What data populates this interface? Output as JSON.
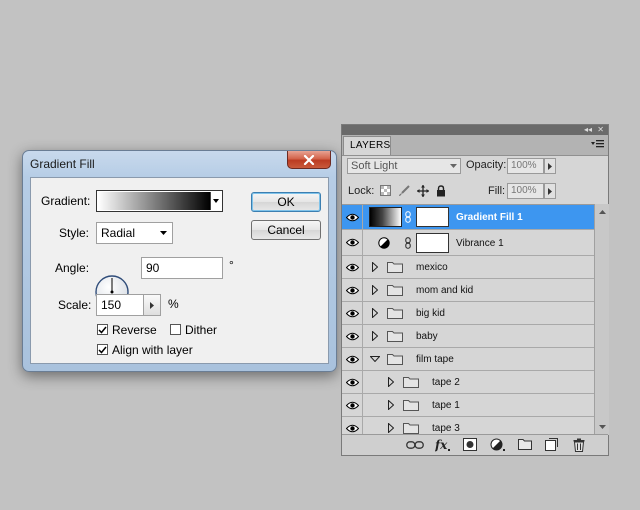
{
  "dialog": {
    "title": "Gradient Fill",
    "gradient_label": "Gradient:",
    "style_label": "Style:",
    "style_value": "Radial",
    "angle_label": "Angle:",
    "angle_value": "90",
    "angle_unit": "°",
    "scale_label": "Scale:",
    "scale_value": "150",
    "scale_unit": "%",
    "reverse_label": "Reverse",
    "reverse_checked": true,
    "dither_label": "Dither",
    "dither_checked": false,
    "align_label": "Align with layer",
    "align_checked": true,
    "ok_label": "OK",
    "cancel_label": "Cancel"
  },
  "layers_panel": {
    "tab_label": "LAYERS",
    "blend_mode": "Soft Light",
    "opacity_label": "Opacity:",
    "opacity_value": "100%",
    "lock_label": "Lock:",
    "fill_label": "Fill:",
    "fill_value": "100%",
    "layers": [
      {
        "name": "Gradient Fill 1",
        "type": "gradient-fill",
        "selected": true
      },
      {
        "name": "Vibrance 1",
        "type": "adjustment"
      },
      {
        "name": "mexico",
        "type": "folder",
        "expanded": false,
        "indent": 0
      },
      {
        "name": "mom and kid",
        "type": "folder",
        "expanded": false,
        "indent": 0
      },
      {
        "name": "big kid",
        "type": "folder",
        "expanded": false,
        "indent": 0
      },
      {
        "name": "baby",
        "type": "folder",
        "expanded": false,
        "indent": 0
      },
      {
        "name": "film tape",
        "type": "folder",
        "expanded": true,
        "indent": 0
      },
      {
        "name": "tape 2",
        "type": "folder",
        "expanded": false,
        "indent": 1
      },
      {
        "name": "tape 1",
        "type": "folder",
        "expanded": false,
        "indent": 1
      },
      {
        "name": "tape 3",
        "type": "folder",
        "expanded": false,
        "indent": 1
      }
    ],
    "bottom_icons": [
      "link-layers-icon",
      "fx-icon",
      "add-mask-icon",
      "adjustment-layer-icon",
      "new-group-icon",
      "new-layer-icon",
      "trash-icon"
    ]
  },
  "colors": {
    "selection": "#3d96f0",
    "panel_bg": "#d6d6d6",
    "desktop_bg": "#c2c2c2"
  }
}
